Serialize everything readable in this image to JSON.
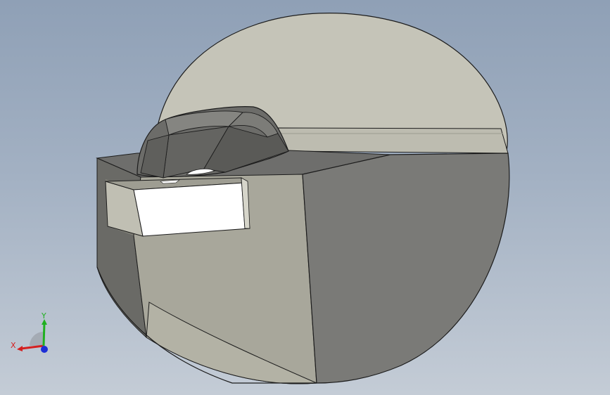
{
  "viewport": {
    "background_top": "#8fa0b6",
    "background_bottom": "#c4ccd6"
  },
  "model": {
    "face_colors": {
      "light": "#c5c4b8",
      "mid": "#a8a79b",
      "dark": "#7a7a77",
      "darker": "#5f5f5c",
      "highlight": "#ffffff"
    },
    "edge_color": "#1c1c1c"
  },
  "triad": {
    "x_label": "X",
    "y_label": "Y",
    "x_color": "#d42020",
    "y_color": "#20b020",
    "z_color": "#1d2fd6"
  }
}
